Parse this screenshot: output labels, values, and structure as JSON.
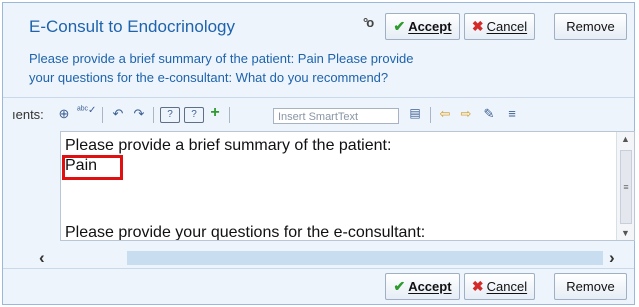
{
  "header": {
    "title": "E-Consult to Endocrinology",
    "accept_label": "Accept",
    "cancel_label": "Cancel",
    "remove_label": "Remove"
  },
  "summary": {
    "line1": "Please provide a brief summary of the patient: Pain Please provide",
    "line2": "your questions for the e-consultant: What do you recommend?"
  },
  "toolbar": {
    "label": "ıents:",
    "smarttext_placeholder": "Insert SmartText"
  },
  "editor": {
    "line1": "Please provide a brief summary of the patient:",
    "line2": "Pain",
    "line3": "Please provide your questions for the e-consultant:"
  },
  "footer": {
    "accept_label": "Accept",
    "cancel_label": "Cancel",
    "remove_label": "Remove"
  },
  "colors": {
    "title": "#1d63ad",
    "highlight_box": "#e01010",
    "accept_check": "#2f9a2f",
    "cancel_x": "#d42a2a"
  },
  "icons": [
    "link-icon",
    "accept-check-icon",
    "cancel-x-icon",
    "add-icon",
    "spellcheck-icon",
    "undo-icon",
    "redo-icon",
    "help-field-icon",
    "help-smartlist-icon",
    "plus-icon",
    "smarttext-browse-icon",
    "previous-field-icon",
    "next-field-icon",
    "edit-link-icon",
    "insert-text-icon"
  ]
}
